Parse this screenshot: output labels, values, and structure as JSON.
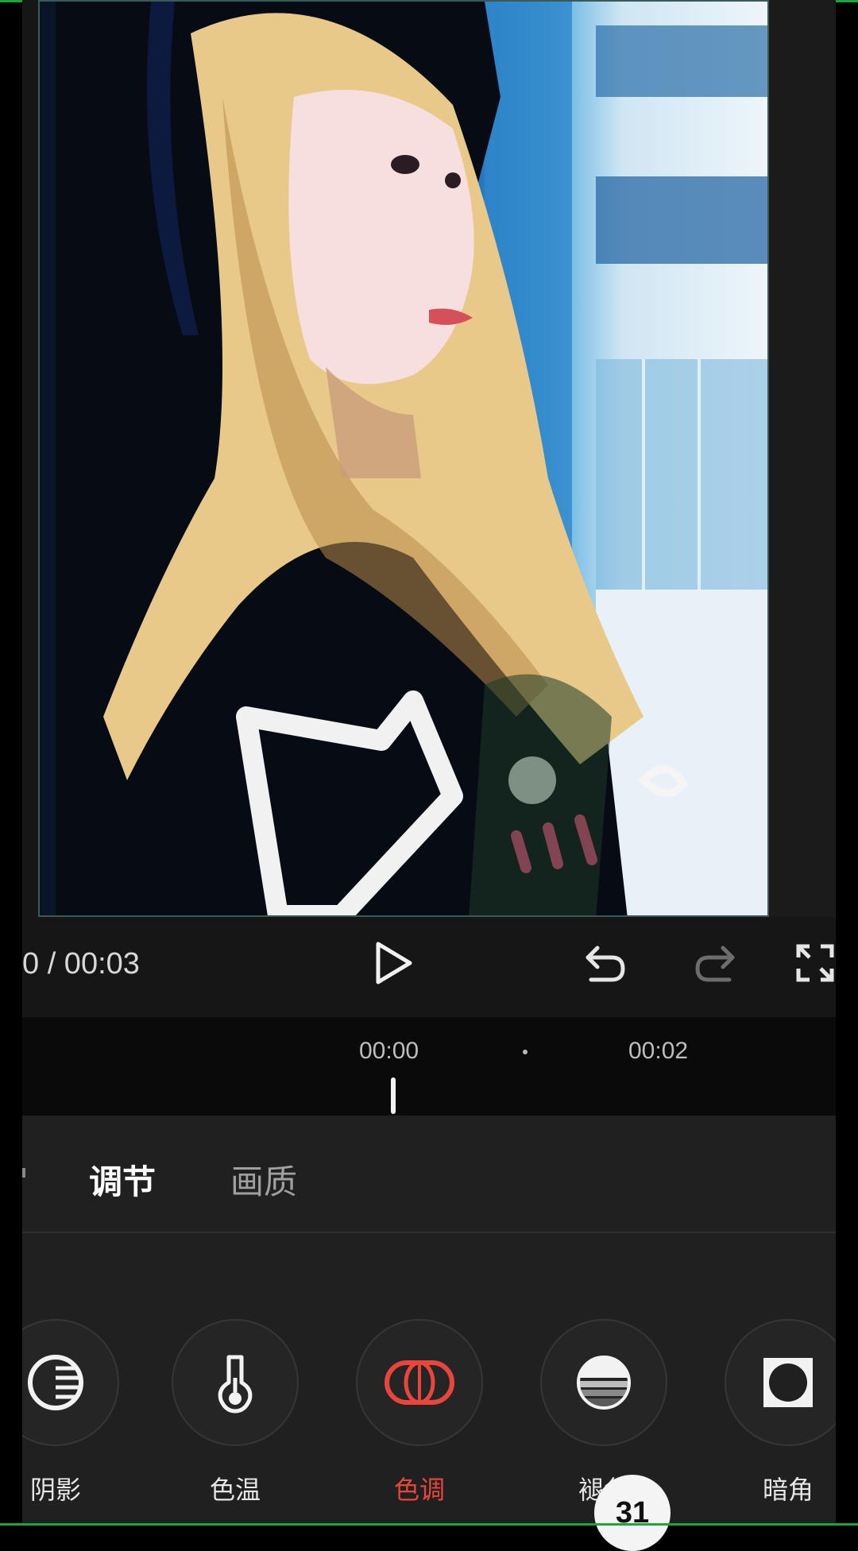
{
  "player": {
    "time_display": "0 / 00:03"
  },
  "timeline": {
    "tick_start": "00:00",
    "tick_mid": "00:02"
  },
  "panel": {
    "tabs": [
      {
        "label": "调节",
        "active": true
      },
      {
        "label": "画质",
        "active": false
      }
    ],
    "tools": [
      {
        "label": "阴影",
        "icon": "shadow-icon"
      },
      {
        "label": "色温",
        "icon": "thermometer-icon"
      },
      {
        "label": "色调",
        "icon": "tint-icon",
        "active": true
      },
      {
        "label": "褪色",
        "icon": "fade-icon"
      },
      {
        "label": "暗角",
        "icon": "vignette-icon"
      }
    ]
  },
  "badge": "31",
  "colors": {
    "accent_active": "#e8463c",
    "panel_bg": "#202020",
    "timeline_bg": "#0a0a0a"
  }
}
